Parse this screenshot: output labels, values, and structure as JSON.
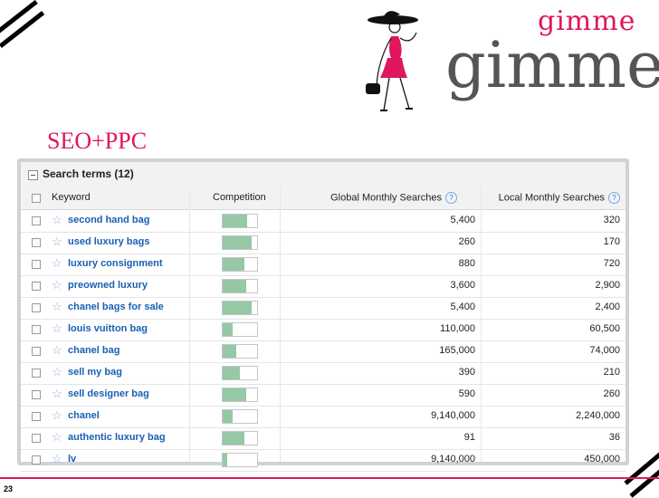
{
  "slide": {
    "title": "SEO+PPC",
    "page_number": "23"
  },
  "logo": {
    "word_top": "gimme",
    "word_bottom": "gimme"
  },
  "panel": {
    "title": "Search terms (12)",
    "columns": {
      "keyword": "Keyword",
      "competition": "Competition",
      "global": "Global Monthly Searches",
      "local": "Local Monthly Searches"
    },
    "help_glyph": "?",
    "star_glyph": "☆",
    "rows": [
      {
        "keyword": "second hand bag",
        "competition": 0.72,
        "global": "5,400",
        "local": "320"
      },
      {
        "keyword": "used luxury bags",
        "competition": 0.85,
        "global": "260",
        "local": "170"
      },
      {
        "keyword": "luxury consignment",
        "competition": 0.62,
        "global": "880",
        "local": "720"
      },
      {
        "keyword": "preowned luxury",
        "competition": 0.68,
        "global": "3,600",
        "local": "2,900"
      },
      {
        "keyword": "chanel bags for sale",
        "competition": 0.85,
        "global": "5,400",
        "local": "2,400"
      },
      {
        "keyword": "louis vuitton bag",
        "competition": 0.28,
        "global": "110,000",
        "local": "60,500"
      },
      {
        "keyword": "chanel bag",
        "competition": 0.4,
        "global": "165,000",
        "local": "74,000"
      },
      {
        "keyword": "sell my bag",
        "competition": 0.5,
        "global": "390",
        "local": "210"
      },
      {
        "keyword": "sell designer bag",
        "competition": 0.68,
        "global": "590",
        "local": "260"
      },
      {
        "keyword": "chanel",
        "competition": 0.28,
        "global": "9,140,000",
        "local": "2,240,000"
      },
      {
        "keyword": "authentic luxury bag",
        "competition": 0.62,
        "global": "91",
        "local": "36"
      },
      {
        "keyword": "lv",
        "competition": 0.12,
        "global": "9,140,000",
        "local": "450,000"
      }
    ]
  },
  "colors": {
    "accent": "#e0165f",
    "link": "#1a5fb4",
    "competition_fill": "#96c8a6"
  }
}
